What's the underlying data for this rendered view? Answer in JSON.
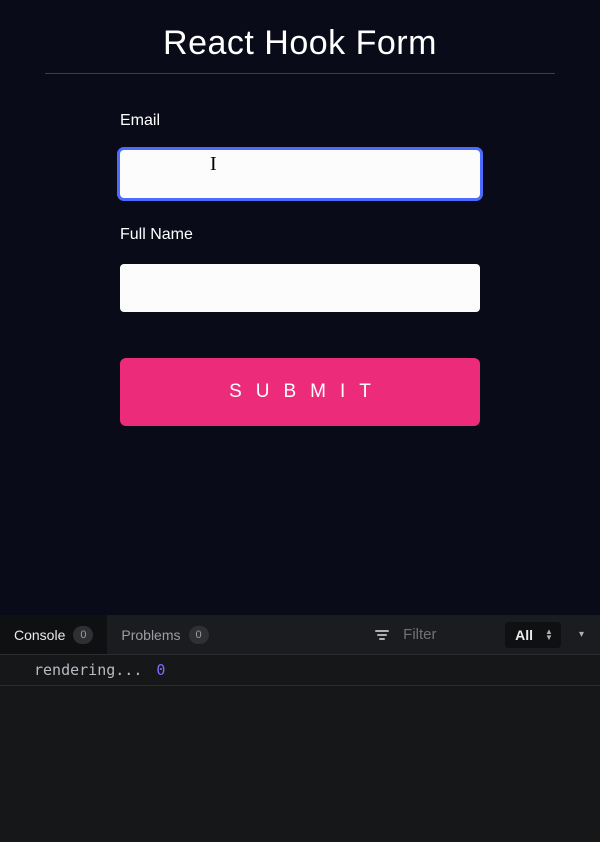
{
  "form": {
    "title": "React Hook Form",
    "email_label": "Email",
    "email_value": "",
    "fullname_label": "Full Name",
    "fullname_value": "",
    "submit_label": "SUBMIT"
  },
  "devtools": {
    "tabs": {
      "console": {
        "label": "Console",
        "badge": "0"
      },
      "problems": {
        "label": "Problems",
        "badge": "0"
      }
    },
    "filter_placeholder": "Filter",
    "level_select": "All",
    "log": {
      "text": "rendering...",
      "value": "0"
    }
  }
}
